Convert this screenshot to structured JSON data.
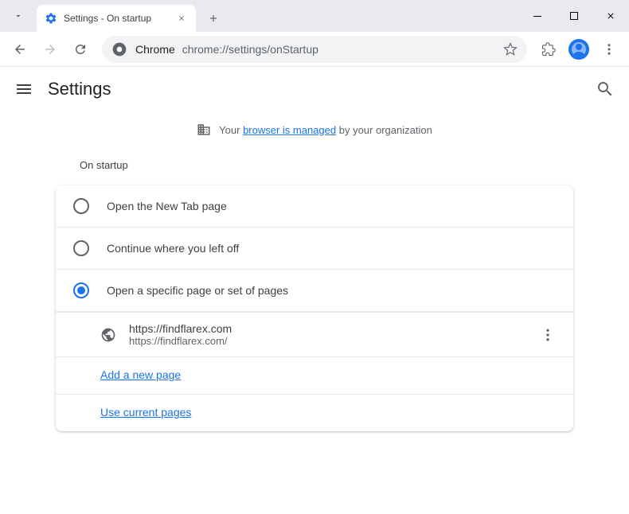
{
  "tab": {
    "title": "Settings - On startup"
  },
  "omnibox": {
    "prefix": "Chrome",
    "url": "chrome://settings/onStartup"
  },
  "header": {
    "title": "Settings"
  },
  "managed": {
    "prefix": "Your ",
    "link": "browser is managed",
    "suffix": " by your organization"
  },
  "section": {
    "title": "On startup"
  },
  "options": {
    "newtab": "Open the New Tab page",
    "continue": "Continue where you left off",
    "specific": "Open a specific page or set of pages"
  },
  "page": {
    "title": "https://findflarex.com",
    "url": "https://findflarex.com/"
  },
  "links": {
    "add": "Add a new page",
    "current": "Use current pages"
  }
}
